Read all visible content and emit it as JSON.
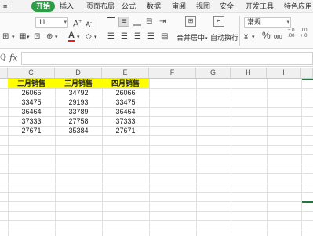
{
  "menu": {
    "items": [
      "开始",
      "插入",
      "页面布局",
      "公式",
      "数据",
      "审阅",
      "视图",
      "安全",
      "开发工具",
      "特色应用"
    ],
    "active": "开始"
  },
  "ribbon": {
    "font_size": "11",
    "font_grow": "A",
    "font_shrink": "A",
    "font_color_letter": "A",
    "merge_label": "合并居中",
    "wrap_label": "自动换行",
    "number_format": "常规",
    "percent": "%",
    "thousands": "000",
    "inc_decimal": "+.0\n.00",
    "dec_decimal": ".00\n+.0"
  },
  "formula_bar": {
    "zoom_glyph": "ℚ",
    "fx": "fx",
    "value": ""
  },
  "columns": [
    "C",
    "D",
    "E",
    "F",
    "G",
    "H",
    "I"
  ],
  "sheet": {
    "headers": [
      "二月销售",
      "三月销售",
      "四月销售"
    ],
    "rows": [
      [
        "26066",
        "34792",
        "26066"
      ],
      [
        "33475",
        "29193",
        "33475"
      ],
      [
        "36464",
        "33789",
        "36464"
      ],
      [
        "37333",
        "27758",
        "37333"
      ],
      [
        "27671",
        "35384",
        "27671"
      ]
    ]
  },
  "colors": {
    "accent": "#2e9d48",
    "highlight": "#ffff00",
    "selection": "#1e7a3a"
  }
}
